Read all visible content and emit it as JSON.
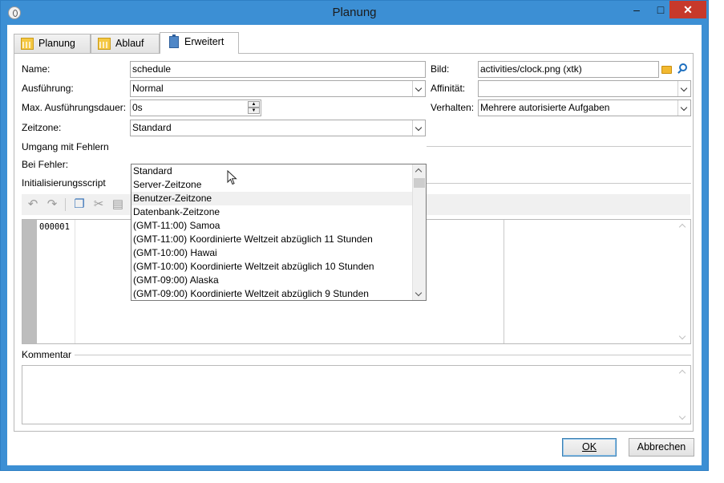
{
  "window": {
    "title": "Planung",
    "controls": {
      "minimize": "–",
      "maximize": "□",
      "close": "✕"
    }
  },
  "tabs": [
    {
      "label": "Planung",
      "icon": "calendar-icon",
      "active": false
    },
    {
      "label": "Ablauf",
      "icon": "calendar-icon",
      "active": false
    },
    {
      "label": "Erweitert",
      "icon": "clipboard-icon",
      "active": true
    }
  ],
  "form": {
    "name_label": "Name:",
    "name_value": "schedule",
    "ausfuehrung_label": "Ausführung:",
    "ausfuehrung_value": "Normal",
    "max_dauer_label": "Max. Ausführungsdauer:",
    "max_dauer_value": "0s",
    "zeitzone_label": "Zeitzone:",
    "zeitzone_value": "Standard",
    "bild_label": "Bild:",
    "bild_value": "activities/clock.png (xtk)",
    "affinitaet_label": "Affinität:",
    "affinitaet_value": "",
    "verhalten_label": "Verhalten:",
    "verhalten_value": "Mehrere autorisierte Aufgaben"
  },
  "sections": {
    "fehler_group": "Umgang mit Fehlern",
    "bei_fehler_label": "Bei Fehler:",
    "init_group": "Initialisierungsscript",
    "kommentar_group": "Kommentar"
  },
  "dropdown_options": [
    "Standard",
    "Server-Zeitzone",
    "Benutzer-Zeitzone",
    "Datenbank-Zeitzone",
    "(GMT-11:00) Samoa",
    "(GMT-11:00) Koordinierte Weltzeit abzüglich 11 Stunden",
    "(GMT-10:00) Hawai",
    "(GMT-10:00) Koordinierte Weltzeit abzüglich 10 Stunden",
    "(GMT-09:00) Alaska",
    "(GMT-09:00) Koordinierte Weltzeit abzüglich 9 Stunden"
  ],
  "dropdown_hover_index": 2,
  "editor": {
    "line_number": "000001"
  },
  "buttons": {
    "ok": "OK",
    "cancel": "Abbrechen"
  },
  "colors": {
    "title_bar": "#3c8fd4",
    "close_button": "#c7392b",
    "folder": "#f2b930",
    "search": "#1d6fbf"
  }
}
